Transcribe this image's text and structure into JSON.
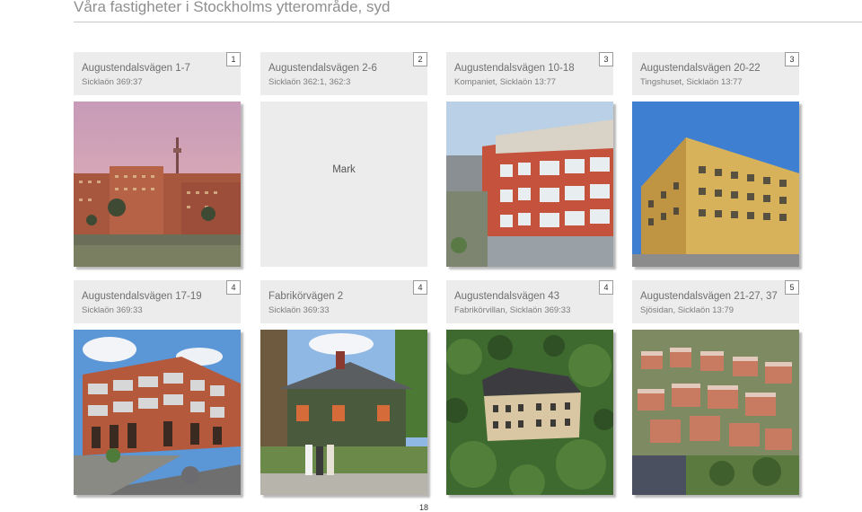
{
  "page": {
    "title": "Våra fastigheter i Stockholms ytterområde, syd",
    "page_number": "18"
  },
  "properties": [
    {
      "name": "Augustendalsvägen 1-7",
      "ref": "Sicklaön 369:37",
      "num": "1",
      "image": "industrial-campus-photo"
    },
    {
      "name": "Augustendalsvägen 2-6",
      "ref": "Sicklaön 362:1, 362:3",
      "num": "2",
      "placeholder": "Mark"
    },
    {
      "name": "Augustendalsvägen 10-18",
      "ref": "Kompaniet, Sicklaön 13:77",
      "num": "3",
      "image": "office-building-photo"
    },
    {
      "name": "Augustendalsvägen 20-22",
      "ref": "Tingshuset, Sicklaön 13:77",
      "num": "3",
      "image": "yellow-office-photo"
    },
    {
      "name": "Augustendalsvägen 17-19",
      "ref": "Sicklaön 369:33",
      "num": "4",
      "image": "brick-building-photo"
    },
    {
      "name": "Fabrikörvägen 2",
      "ref": "Sicklaön 369:33",
      "num": "4",
      "image": "wooden-house-photo"
    },
    {
      "name": "Augustendalsvägen 43",
      "ref": "Fabrikörvillan, Sicklaön 369:33",
      "num": "4",
      "image": "villa-aerial-photo"
    },
    {
      "name": "Augustendalsvägen 21-27, 37",
      "ref": "Sjösidan, Sicklaön 13:79",
      "num": "5",
      "image": "apartments-aerial-photo"
    }
  ]
}
